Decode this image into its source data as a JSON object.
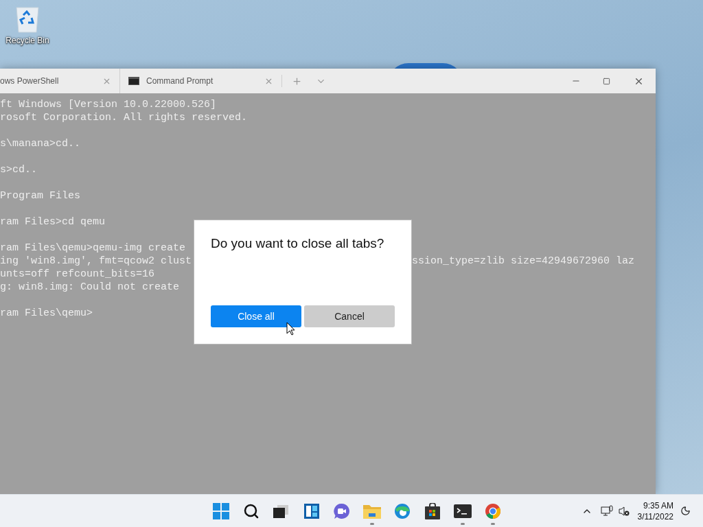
{
  "desktop": {
    "icons": [
      {
        "label": "Recycle Bin"
      }
    ]
  },
  "window": {
    "tabs": [
      {
        "label": "ows PowerShell"
      },
      {
        "label": "Command Prompt"
      }
    ]
  },
  "terminal": {
    "blocks": [
      {
        "lines": [
          {
            "text": "ft Windows [Version 10.0.22000.526]"
          },
          {
            "text": "rosoft Corporation. All rights reserved."
          }
        ]
      },
      {
        "lines": [
          {
            "text": "s\\manana>cd.."
          }
        ]
      },
      {
        "lines": [
          {
            "text": "s>cd.."
          }
        ]
      },
      {
        "lines": [
          {
            "text": "Program Files"
          }
        ]
      },
      {
        "lines": [
          {
            "text": "ram Files>cd qemu"
          }
        ]
      },
      {
        "lines": [
          {
            "text": "ram Files\\qemu>qemu-img create"
          },
          {
            "text": "ing 'win8.img', fmt=qcow2 clust",
            "continued": "ssion_type=zlib size=42949672960 laz"
          },
          {
            "text": "unts=off refcount_bits=16"
          },
          {
            "text": "g: win8.img: Could not create"
          }
        ]
      },
      {
        "lines": [
          {
            "text": "ram Files\\qemu>"
          }
        ]
      }
    ]
  },
  "dialog": {
    "title": "Do you want to close all tabs?",
    "buttons": [
      {
        "label": "Close all",
        "kind": "primary"
      },
      {
        "label": "Cancel",
        "kind": "secondary"
      }
    ]
  },
  "taskbar": {
    "apps": [
      {
        "running": false
      },
      {
        "running": false
      },
      {
        "running": false
      },
      {
        "running": false
      },
      {
        "running": false
      },
      {
        "running": true
      },
      {
        "running": false
      },
      {
        "running": false
      },
      {
        "running": true
      },
      {
        "running": true
      }
    ],
    "clock": {
      "time": "9:35 AM",
      "date": "3/11/2022"
    }
  }
}
